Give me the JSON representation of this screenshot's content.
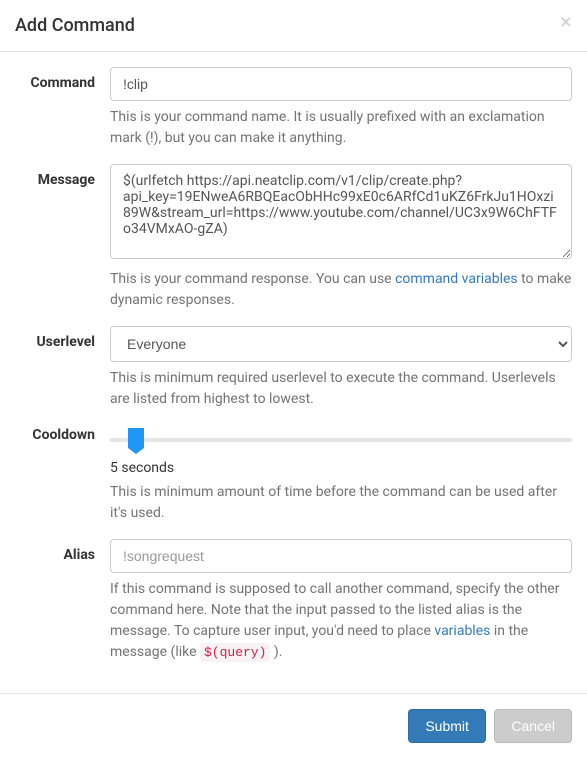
{
  "header": {
    "title": "Add Command"
  },
  "fields": {
    "command": {
      "label": "Command",
      "value": "!clip",
      "help": "This is your command name. It is usually prefixed with an exclamation mark (!), but you can make it anything."
    },
    "message": {
      "label": "Message",
      "value": "$(urlfetch https://api.neatclip.com/v1/clip/create.php?api_key=19ENweA6RBQEacObHHc99xE0c6ARfCd1uKZ6FrkJu1HOxzi89W&stream_url=https://www.youtube.com/channel/UC3x9W6ChFTFo34VMxAO-gZA)",
      "help_before": "This is your command response. You can use ",
      "help_link": "command variables",
      "help_after": " to make dynamic responses."
    },
    "userlevel": {
      "label": "Userlevel",
      "value": "Everyone",
      "help": "This is minimum required userlevel to execute the command. Userlevels are listed from highest to lowest."
    },
    "cooldown": {
      "label": "Cooldown",
      "display_value": "5 seconds",
      "help": "This is minimum amount of time before the command can be used after it's used."
    },
    "alias": {
      "label": "Alias",
      "placeholder": "!songrequest",
      "help_part1": "If this command is supposed to call another command, specify the other command here. Note that the input passed to the listed alias is the message. To capture user input, you'd need to place ",
      "help_link": "variables",
      "help_part2": " in the message (like ",
      "help_code": "$(query)",
      "help_part3": " )."
    }
  },
  "footer": {
    "submit": "Submit",
    "cancel": "Cancel"
  }
}
